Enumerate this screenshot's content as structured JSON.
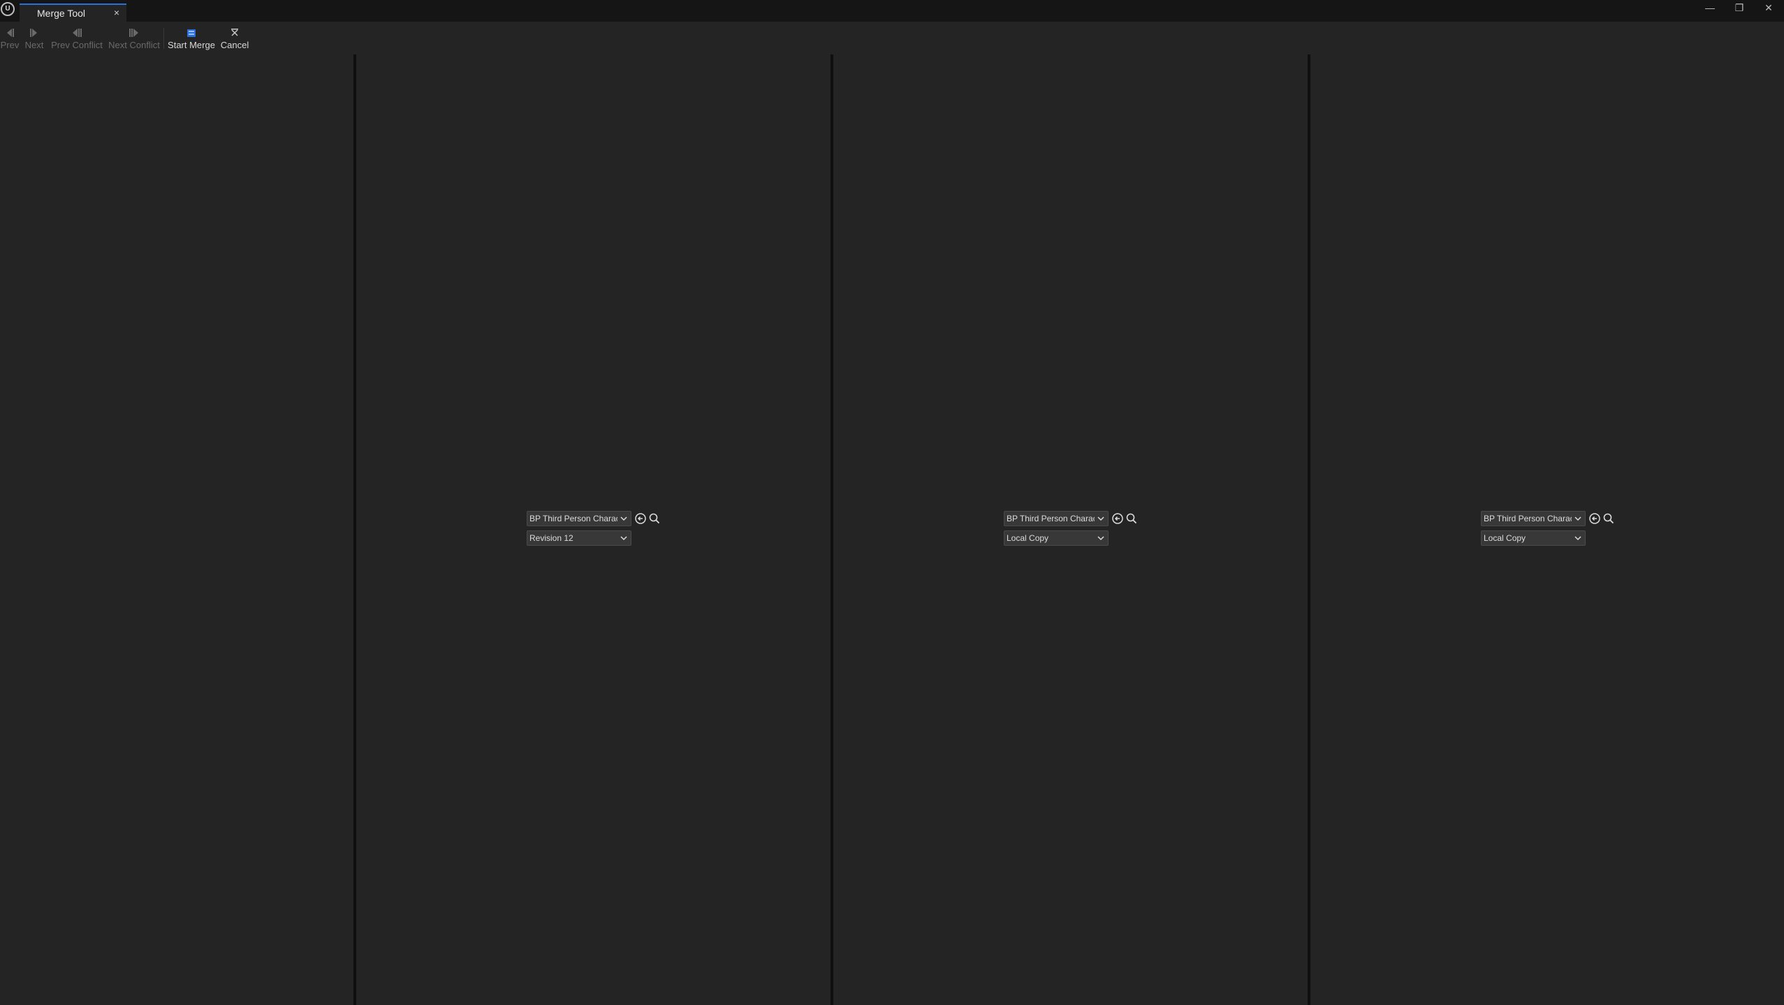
{
  "window": {
    "tab_title": "Merge Tool",
    "tab_close": "×",
    "logo": "U",
    "controls": {
      "minimize": "—",
      "restore": "❐",
      "close": "✕"
    }
  },
  "toolbar": {
    "prev": "Prev",
    "next": "Next",
    "prev_conflict": "Prev Conflict",
    "next_conflict": "Next Conflict",
    "start_merge": "Start Merge",
    "cancel": "Cancel"
  },
  "panels": [
    {
      "asset": "BP Third Person Character",
      "revision": "Revision 12"
    },
    {
      "asset": "BP Third Person Character",
      "revision": "Local Copy"
    },
    {
      "asset": "BP Third Person Character",
      "revision": "Local Copy"
    }
  ],
  "colors": {
    "accent": "#2b6fd8",
    "background": "#242424",
    "titlebar": "#151515"
  },
  "icons": [
    "unreal-logo-icon",
    "prev-icon",
    "next-icon",
    "prev-conflict-icon",
    "next-conflict-icon",
    "start-merge-icon",
    "cancel-icon",
    "browse-to-asset-icon",
    "search-icon",
    "chevron-down-icon"
  ]
}
